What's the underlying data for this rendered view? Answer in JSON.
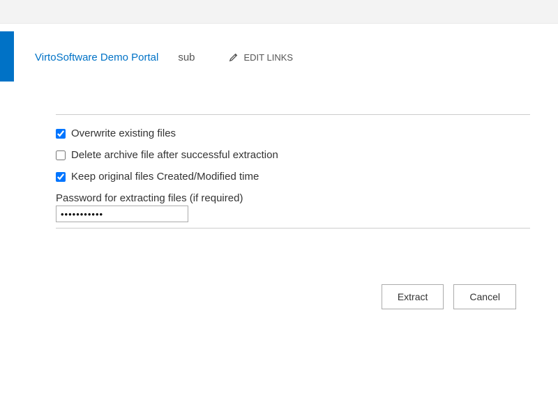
{
  "header": {
    "portal_link": "VirtoSoftware Demo Portal",
    "sub_label": "sub",
    "edit_links_label": "EDIT LINKS"
  },
  "options": {
    "overwrite": {
      "label": "Overwrite existing files",
      "checked": true
    },
    "delete_archive": {
      "label": "Delete archive file after successful extraction",
      "checked": false
    },
    "keep_time": {
      "label": "Keep original files Created/Modified time",
      "checked": true
    }
  },
  "password": {
    "label": "Password for extracting files (if required)",
    "value": "•••••••••••"
  },
  "buttons": {
    "extract": "Extract",
    "cancel": "Cancel"
  }
}
